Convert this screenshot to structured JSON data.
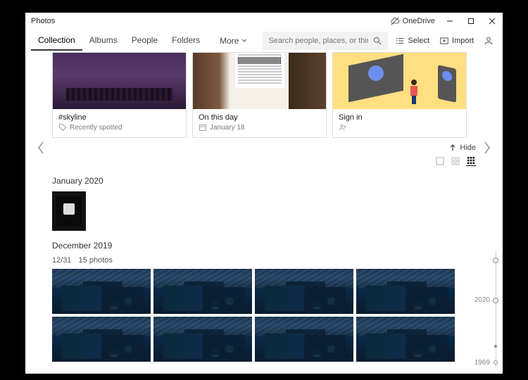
{
  "window": {
    "title": "Photos",
    "cloud_label": "OneDrive"
  },
  "nav": {
    "tabs": [
      "Collection",
      "Albums",
      "People",
      "Folders"
    ],
    "active": 0,
    "more_label": "More"
  },
  "search": {
    "placeholder": "Search people, places, or things..."
  },
  "commands": {
    "select": "Select",
    "import": "Import"
  },
  "featured_cards": [
    {
      "title": "#skyline",
      "sub_icon": "tag",
      "sub_text": "Recently spotted"
    },
    {
      "title": "On this day",
      "sub_icon": "calendar",
      "sub_text": "January 18"
    },
    {
      "title": "Sign in",
      "sub_icon": "person-add",
      "sub_text": ""
    }
  ],
  "hide_label": "Hide",
  "sections": [
    {
      "title": "January 2020",
      "groups": [
        {
          "date": "",
          "count_label": "",
          "thumbs": 1,
          "style": "shirt"
        }
      ]
    },
    {
      "title": "December 2019",
      "groups": [
        {
          "date": "12/31",
          "count_label": "15 photos",
          "thumbs": 8,
          "style": "city"
        }
      ]
    }
  ],
  "timeline": {
    "labels": [
      {
        "text": "2020",
        "pos": 0.42
      },
      {
        "text": "1969",
        "pos": 0.96
      }
    ]
  }
}
